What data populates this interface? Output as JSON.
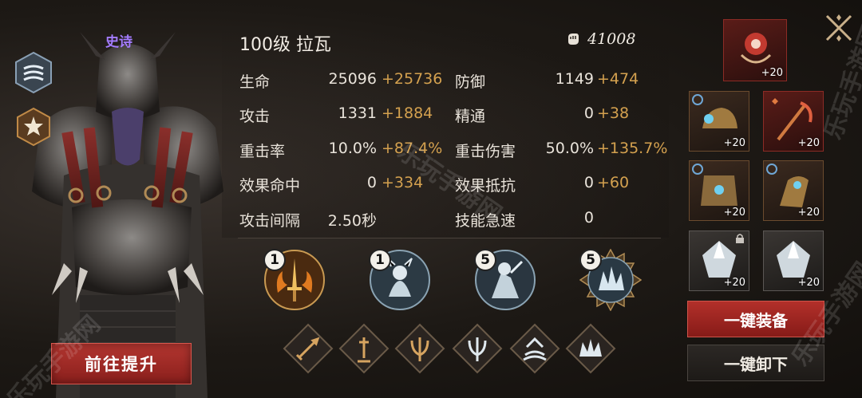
{
  "character": {
    "rarity": "史诗",
    "level_name": "100级  拉瓦",
    "upgrade_button": "前往提升",
    "power": "41008"
  },
  "stats": [
    {
      "label": "生命",
      "base": "25096",
      "bonus": "+25736"
    },
    {
      "label": "防御",
      "base": "1149",
      "bonus": "+474"
    },
    {
      "label": "攻击",
      "base": "1331",
      "bonus": "+1884"
    },
    {
      "label": "精通",
      "base": "0",
      "bonus": "+38"
    },
    {
      "label": "重击率",
      "base": "10.0%",
      "bonus": "+87.4%"
    },
    {
      "label": "重击伤害",
      "base": "50.0%",
      "bonus": "+135.7%"
    },
    {
      "label": "效果命中",
      "base": "0",
      "bonus": "+334"
    },
    {
      "label": "效果抵抗",
      "base": "0",
      "bonus": "+60"
    },
    {
      "label": "攻击间隔",
      "base": "2.50秒",
      "bonus": ""
    },
    {
      "label": "技能急速",
      "base": "0",
      "bonus": ""
    }
  ],
  "skills": [
    {
      "level": "1",
      "icon": "fire-sword-skill-icon"
    },
    {
      "level": "1",
      "icon": "knight-skill-icon"
    },
    {
      "level": "5",
      "icon": "warrior-skill-icon"
    },
    {
      "level": "5",
      "icon": "ice-crystal-skill-icon"
    }
  ],
  "runes": [
    "sword-rune-icon",
    "dagger-rune-icon",
    "trident-rune-icon",
    "trident-rune-icon-2",
    "arrow-rune-icon",
    "crown-rune-icon"
  ],
  "equipment": {
    "amulet": "+20",
    "slots": [
      "+20",
      "+20",
      "+20",
      "+20",
      "+20",
      "+20"
    ]
  },
  "buttons": {
    "equip_all": "一键装备",
    "unequip_all": "一键卸下"
  },
  "watermarks": [
    "乐玩手游网",
    "乐玩手游网",
    "乐玩手游网",
    "乐玩手游网"
  ],
  "colors": {
    "bonus": "#d4a14f",
    "rarity": "#a47cff",
    "accent_red": "#b3302a"
  }
}
